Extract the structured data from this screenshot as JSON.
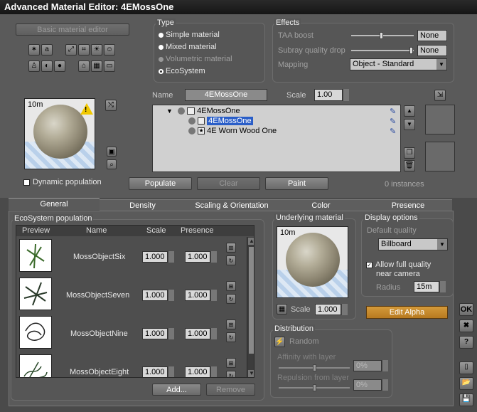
{
  "title": "Advanced Material Editor: 4EMossOne",
  "basic_editor_label": "Basic material editor",
  "type_group": {
    "label": "Type",
    "options": [
      {
        "label": "Simple material",
        "selected": false,
        "enabled": true
      },
      {
        "label": "Mixed material",
        "selected": false,
        "enabled": true
      },
      {
        "label": "Volumetric material",
        "selected": false,
        "enabled": false
      },
      {
        "label": "EcoSystem",
        "selected": true,
        "enabled": true
      }
    ]
  },
  "effects_group": {
    "label": "Effects",
    "taa_label": "TAA boost",
    "taa_value": "None",
    "taa_level": 0.35,
    "subray_label": "Subray quality drop",
    "subray_value": "None",
    "subray_level": 1.0,
    "mapping_label": "Mapping",
    "mapping_value": "Object - Standard"
  },
  "preview": {
    "distance": "10m"
  },
  "name_label": "Name",
  "name_value": "4EMossOne",
  "scale_label": "Scale",
  "scale_value": "1.00",
  "tree": [
    {
      "label": "4EMossOne",
      "level": 0,
      "selected": false
    },
    {
      "label": "4EMossOne",
      "level": 1,
      "selected": true
    },
    {
      "label": "4E Worn Wood One",
      "level": 1,
      "selected": false
    }
  ],
  "dynamic_population_label": "Dynamic population",
  "populate_label": "Populate",
  "clear_label": "Clear",
  "paint_label": "Paint",
  "instances_label": "0 instances",
  "tabs": [
    "General",
    "Density",
    "Scaling & Orientation",
    "Color",
    "Presence"
  ],
  "eco_population": {
    "label": "EcoSystem population",
    "headers": [
      "Preview",
      "Name",
      "Scale",
      "Presence"
    ],
    "rows": [
      {
        "name": "MossObjectSix",
        "scale": "1.000",
        "presence": "1.000"
      },
      {
        "name": "MossObjectSeven",
        "scale": "1.000",
        "presence": "1.000"
      },
      {
        "name": "MossObjectNine",
        "scale": "1.000",
        "presence": "1.000"
      },
      {
        "name": "MossObjectEight",
        "scale": "1.000",
        "presence": "1.000"
      }
    ],
    "add_label": "Add...",
    "remove_label": "Remove"
  },
  "underlying": {
    "label": "Underlying material",
    "distance": "10m",
    "scale_label": "Scale",
    "scale_value": "1.000"
  },
  "display_options": {
    "label": "Display options",
    "default_quality_label": "Default quality",
    "quality_value": "Billboard",
    "allow_label_1": "Allow full quality",
    "allow_label_2": "near camera",
    "radius_label": "Radius",
    "radius_value": "15m"
  },
  "edit_alpha_label": "Edit Alpha",
  "distribution": {
    "label": "Distribution",
    "random_label": "Random",
    "affinity_label": "Affinity with layer",
    "affinity_value": "0%",
    "repulsion_label": "Repulsion from layer",
    "repulsion_value": "0%"
  },
  "side_buttons": {
    "ok": "OK",
    "close": "✖",
    "help": "?"
  }
}
